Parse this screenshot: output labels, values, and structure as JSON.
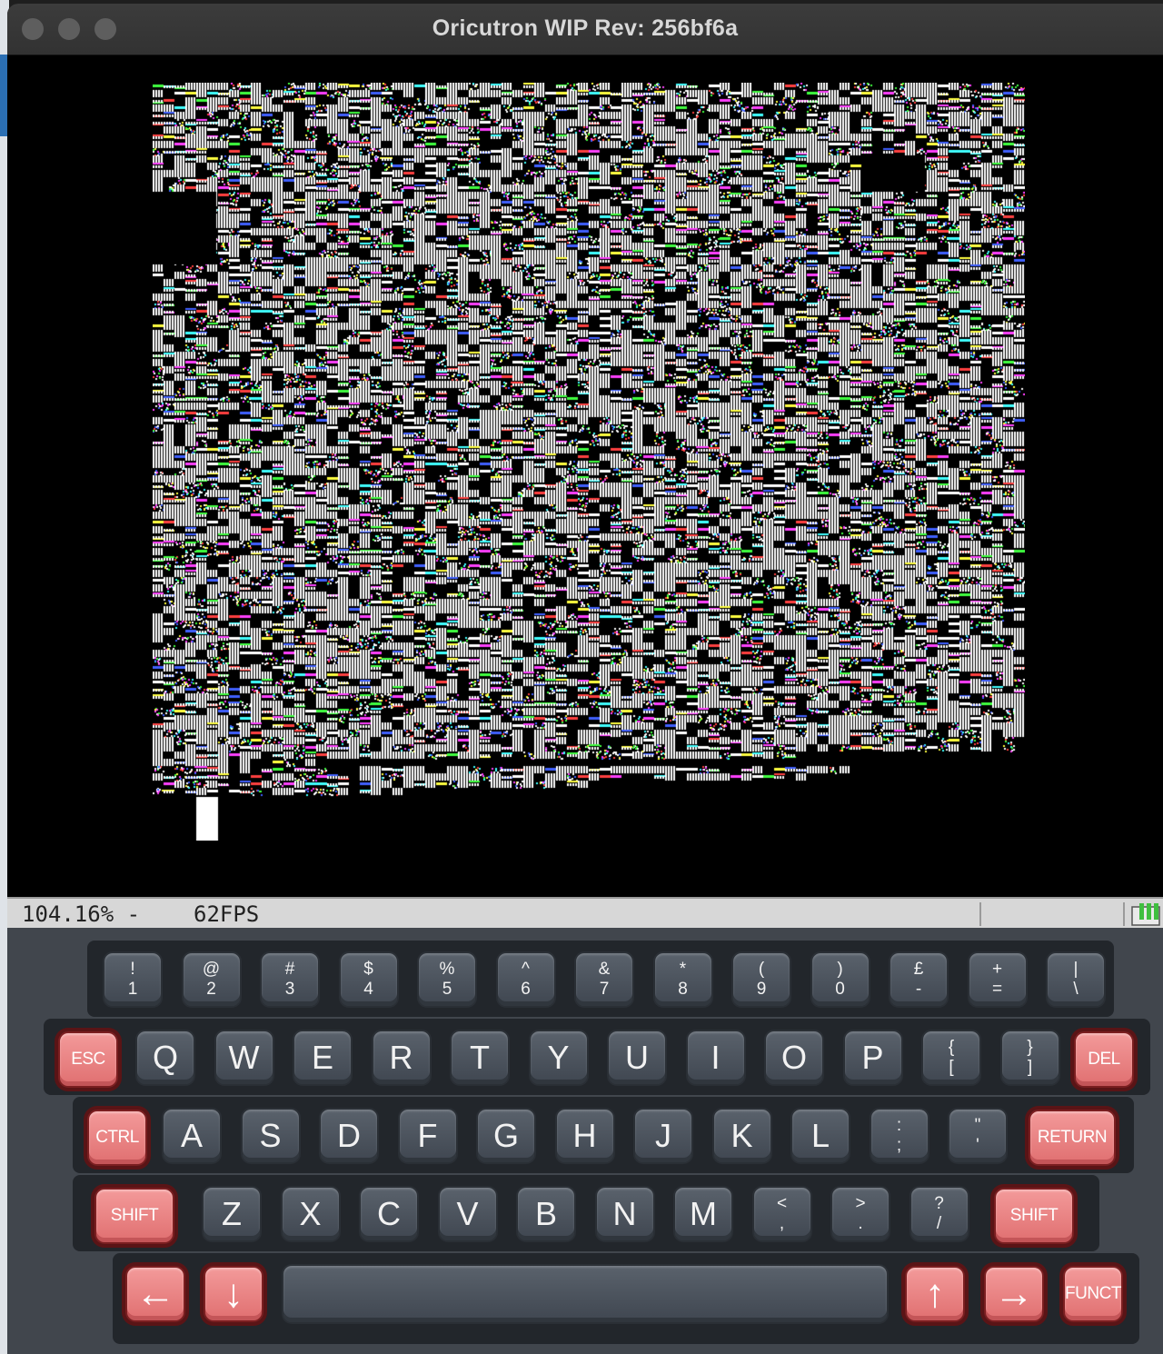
{
  "window": {
    "title": "Oricutron WIP Rev: 256bf6a"
  },
  "status": {
    "speed": "104.16% -",
    "fps": "62FPS"
  },
  "keyboard": {
    "row1": [
      {
        "top": "!",
        "bottom": "1"
      },
      {
        "top": "@",
        "bottom": "2"
      },
      {
        "top": "#",
        "bottom": "3"
      },
      {
        "top": "$",
        "bottom": "4"
      },
      {
        "top": "%",
        "bottom": "5"
      },
      {
        "top": "^",
        "bottom": "6"
      },
      {
        "top": "&",
        "bottom": "7"
      },
      {
        "top": "*",
        "bottom": "8"
      },
      {
        "top": "(",
        "bottom": "9"
      },
      {
        "top": ")",
        "bottom": "0"
      },
      {
        "top": "£",
        "bottom": "-"
      },
      {
        "top": "+",
        "bottom": "="
      },
      {
        "top": "|",
        "bottom": "\\"
      }
    ],
    "row2": [
      "Q",
      "W",
      "E",
      "R",
      "T",
      "Y",
      "U",
      "I",
      "O",
      "P"
    ],
    "row2_brackets": [
      {
        "top": "{",
        "bottom": "["
      },
      {
        "top": "}",
        "bottom": "]"
      }
    ],
    "row3": [
      "A",
      "S",
      "D",
      "F",
      "G",
      "H",
      "J",
      "K",
      "L"
    ],
    "row3_punct": [
      {
        "top": ":",
        "bottom": ";"
      },
      {
        "top": "\"",
        "bottom": "'"
      }
    ],
    "row4": [
      "Z",
      "X",
      "C",
      "V",
      "B",
      "N",
      "M"
    ],
    "row4_punct": [
      {
        "top": "<",
        "bottom": ","
      },
      {
        "top": ">",
        "bottom": "."
      },
      {
        "top": "?",
        "bottom": "/"
      }
    ],
    "esc_label": "ESC",
    "del_label": "DEL",
    "ctrl_label": "CTRL",
    "return_label": "RETURN",
    "shift_left_label": "SHIFT",
    "shift_right_label": "SHIFT",
    "funct_label": "FUNCT",
    "left_arrow": "←",
    "down_arrow": "↓",
    "up_arrow": "↑",
    "right_arrow": "→"
  },
  "colors": {
    "screen_bg": "#000000",
    "key_dark": "#4b525b",
    "key_red": "#eb8284",
    "status_bg": "#d7d7d7"
  }
}
